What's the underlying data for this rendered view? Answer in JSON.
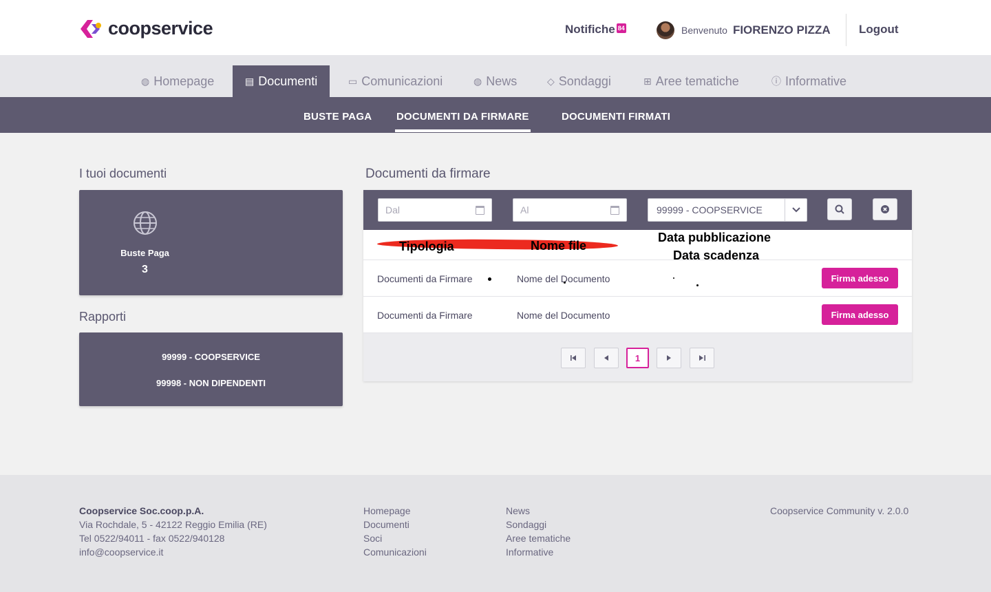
{
  "header": {
    "brand": "coopservice",
    "notifications_label": "Notifiche",
    "notifications_count": "84",
    "welcome": "Benvenuto",
    "user_name": "FIORENZO PIZZA",
    "logout": "Logout"
  },
  "main_tabs": [
    {
      "label": "Homepage",
      "icon": "globe-icon",
      "active": false
    },
    {
      "label": "Documenti",
      "icon": "document-icon",
      "active": true
    },
    {
      "label": "Comunicazioni",
      "icon": "chat-icon",
      "active": false
    },
    {
      "label": "News",
      "icon": "globe-icon",
      "active": false
    },
    {
      "label": "Sondaggi",
      "icon": "tag-icon",
      "active": false
    },
    {
      "label": "Aree tematiche",
      "icon": "grid-icon",
      "active": false
    },
    {
      "label": "Informative",
      "icon": "info-icon",
      "active": false
    }
  ],
  "sub_tabs": [
    {
      "label": "BUSTE PAGA",
      "active": false
    },
    {
      "label": "DOCUMENTI DA FIRMARE",
      "active": true
    },
    {
      "label": "DOCUMENTI FIRMATI",
      "active": false
    }
  ],
  "left": {
    "documents_title": "I tuoi documenti",
    "buste_label": "Buste Paga",
    "buste_count": "3",
    "reports_title": "Rapporti",
    "reports": [
      "99999 - COOPSERVICE",
      "99998 - NON DIPENDENTI"
    ]
  },
  "right": {
    "title": "Documenti da firmare",
    "filters": {
      "from_placeholder": "Dal",
      "to_placeholder": "Al",
      "company_value": "99999 - COOPSERVICE"
    },
    "table": {
      "col_tipologia": "Tipologia",
      "col_nome_file": "Nome file",
      "col_pubblicazione": "Data pubblicazione",
      "col_scadenza": "Data scadenza",
      "rows": [
        {
          "tipologia": "Documenti da Firmare",
          "nome": "Nome del Documento",
          "action": "Firma adesso"
        },
        {
          "tipologia": "Documenti da Firmare",
          "nome": "Nome del Documento",
          "action": "Firma adesso"
        }
      ]
    },
    "pagination": {
      "current_page": "1"
    }
  },
  "footer": {
    "company": "Coopservice Soc.coop.p.A.",
    "address": "Via Rochdale, 5 - 42122 Reggio Emilia (RE)",
    "phone": "Tel 0522/94011 - fax 0522/940128",
    "email": "info@coopservice.it",
    "links_col1": [
      "Homepage",
      "Documenti",
      "Soci",
      "Comunicazioni"
    ],
    "links_col2": [
      "News",
      "Sondaggi",
      "Aree tematiche",
      "Informative"
    ],
    "version": "Coopservice Community v. 2.0.0"
  },
  "colors": {
    "accent": "#d6219a",
    "primary_dark": "#5e5a70"
  }
}
